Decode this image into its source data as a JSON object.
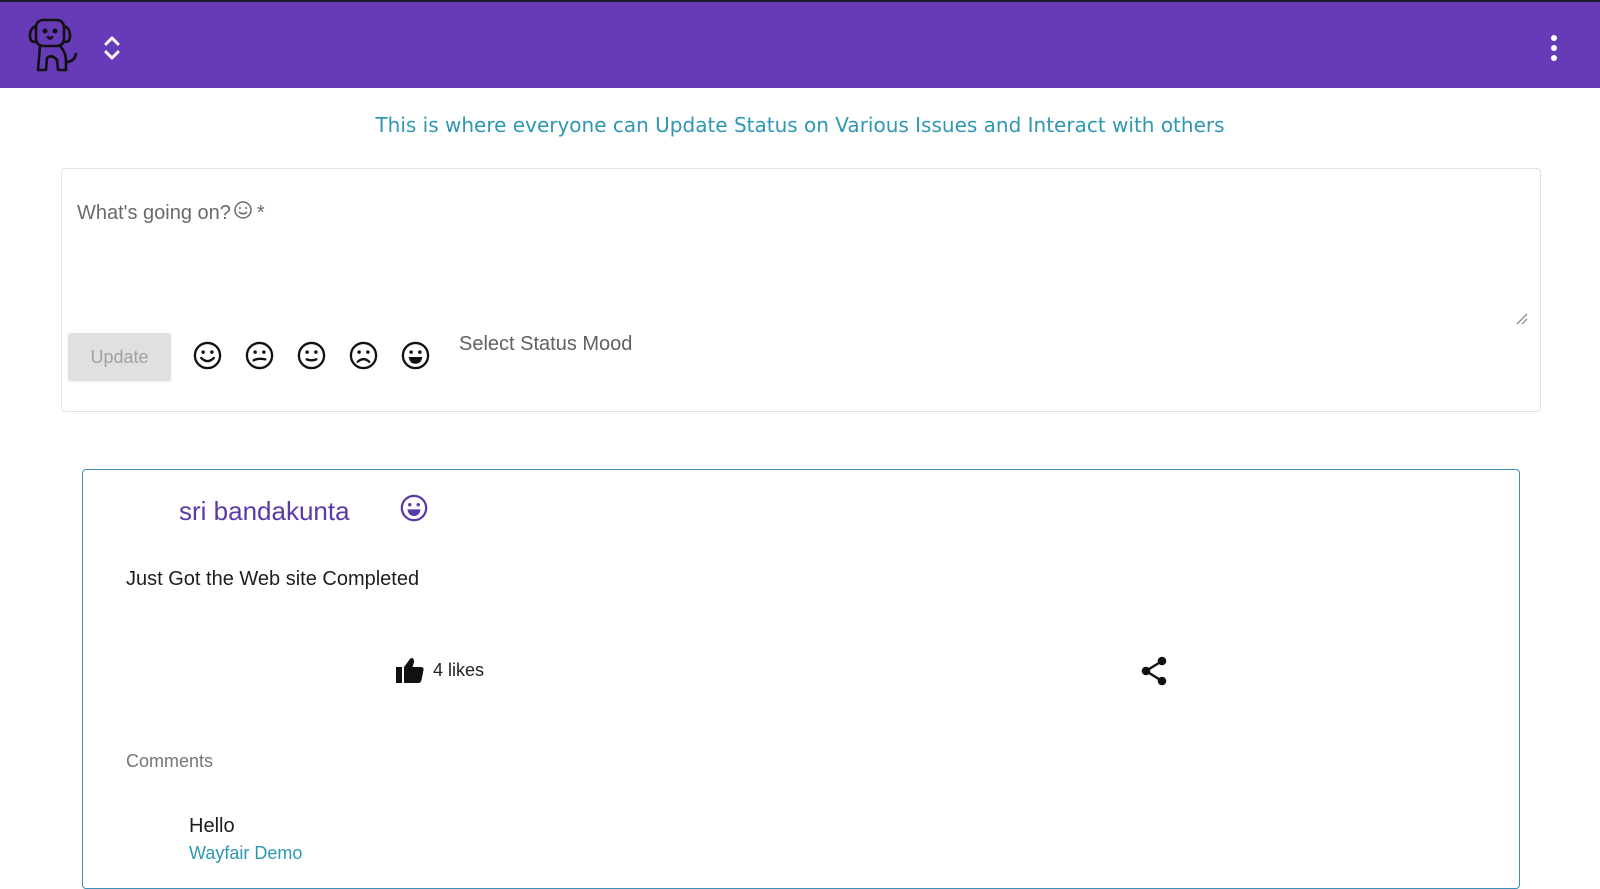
{
  "header": {
    "brand_color": "#673ab7",
    "logo_icon": "puppy-logo-icon",
    "switcher_icon": "unfold-more-icon",
    "menu_icon": "more-vert-icon"
  },
  "tagline": "This is where everyone can Update Status on Various Issues and Interact with others",
  "composer": {
    "label": "What's going on?",
    "required_mark": "*",
    "value": "",
    "update_label": "Update",
    "mood_prompt": "Select Status Mood",
    "moods": [
      {
        "name": "smile-icon"
      },
      {
        "name": "confused-icon"
      },
      {
        "name": "neutral-icon"
      },
      {
        "name": "sad-icon"
      },
      {
        "name": "grin-icon"
      }
    ]
  },
  "post": {
    "author": "sri bandakunta",
    "mood_icon": "grin-icon",
    "text": "Just Got the Web site Completed",
    "likes_label": "4 likes",
    "like_icon": "thumb-up-icon",
    "share_icon": "share-icon",
    "comments_heading": "Comments",
    "comments": [
      {
        "text": "Hello",
        "author": "Wayfair Demo"
      }
    ]
  },
  "colors": {
    "accent_text": "#2e97b3",
    "author_text": "#5b3aa8",
    "card_border": "#3e8fb7"
  }
}
